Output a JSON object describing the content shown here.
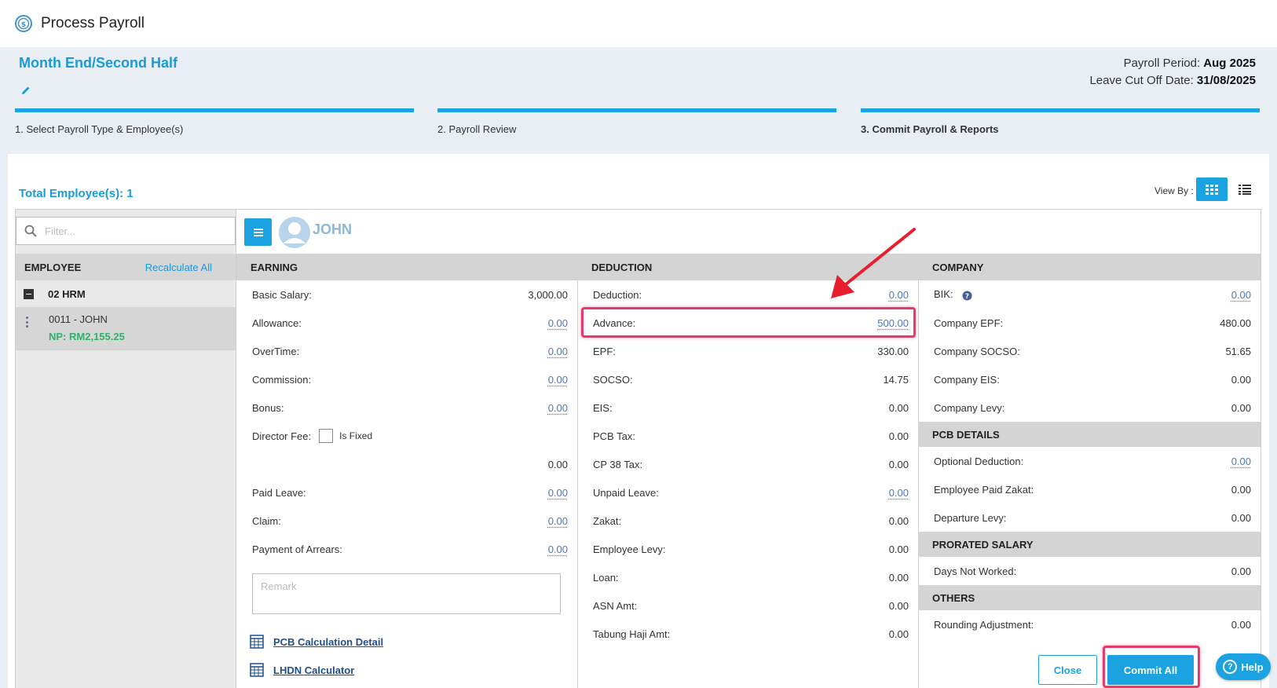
{
  "app": {
    "title": "Process Payroll"
  },
  "period": {
    "name": "Month End/Second Half",
    "payroll_period_label": "Payroll Period:",
    "payroll_period_value": "Aug 2025",
    "cutoff_label": "Leave Cut Off Date:",
    "cutoff_value": "31/08/2025"
  },
  "steps": [
    {
      "label": "1. Select Payroll Type & Employee(s)"
    },
    {
      "label": "2. Payroll Review"
    },
    {
      "label": "3. Commit Payroll & Reports"
    }
  ],
  "total_employees": "Total Employee(s): 1",
  "view_by": "View By :",
  "filter_placeholder": "Filter...",
  "employee_list": {
    "header": "EMPLOYEE",
    "recalculate": "Recalculate All",
    "group": "02 HRM",
    "employee": "0011 - JOHN",
    "net_pay": "NP: RM2,155.25"
  },
  "employee_name": "JOHN",
  "earning": {
    "title": "EARNING",
    "rows": [
      {
        "label": "Basic Salary:",
        "value": "3,000.00"
      },
      {
        "label": "Allowance:",
        "value": "0.00"
      },
      {
        "label": "OverTime:",
        "value": "0.00"
      },
      {
        "label": "Commission:",
        "value": "0.00"
      },
      {
        "label": "Bonus:",
        "value": "0.00"
      }
    ],
    "director_fee_label": "Director Fee:",
    "is_fixed_label": "Is Fixed",
    "director_fee_value": "0.00",
    "rows2": [
      {
        "label": "Paid Leave:",
        "value": "0.00"
      },
      {
        "label": "Claim:",
        "value": "0.00"
      },
      {
        "label": "Payment of Arrears:",
        "value": "0.00"
      }
    ],
    "remark_placeholder": "Remark",
    "pcb_link": "PCB Calculation Detail",
    "lhdn_link": "LHDN Calculator"
  },
  "deduction": {
    "title": "DEDUCTION",
    "rows": [
      {
        "label": "Deduction:",
        "value": "0.00"
      },
      {
        "label": "Advance:",
        "value": "500.00"
      },
      {
        "label": "EPF:",
        "value": "330.00"
      },
      {
        "label": "SOCSO:",
        "value": "14.75"
      },
      {
        "label": "EIS:",
        "value": "0.00"
      },
      {
        "label": "PCB Tax:",
        "value": "0.00"
      },
      {
        "label": "CP 38 Tax:",
        "value": "0.00"
      },
      {
        "label": "Unpaid Leave:",
        "value": "0.00"
      },
      {
        "label": "Zakat:",
        "value": "0.00"
      },
      {
        "label": "Employee Levy:",
        "value": "0.00"
      },
      {
        "label": "Loan:",
        "value": "0.00"
      },
      {
        "label": "ASN Amt:",
        "value": "0.00"
      },
      {
        "label": "Tabung Haji Amt:",
        "value": "0.00"
      }
    ]
  },
  "company": {
    "title": "COMPANY",
    "rows": [
      {
        "label": "BIK:",
        "value": "0.00"
      },
      {
        "label": "Company EPF:",
        "value": "480.00"
      },
      {
        "label": "Company SOCSO:",
        "value": "51.65"
      },
      {
        "label": "Company EIS:",
        "value": "0.00"
      },
      {
        "label": "Company Levy:",
        "value": "0.00"
      }
    ],
    "pcb_title": "PCB DETAILS",
    "pcb_rows": [
      {
        "label": "Optional Deduction:",
        "value": "0.00"
      },
      {
        "label": "Employee Paid Zakat:",
        "value": "0.00"
      },
      {
        "label": "Departure Levy:",
        "value": "0.00"
      }
    ],
    "prorated_title": "PRORATED SALARY",
    "prorated_rows": [
      {
        "label": "Days Not Worked:",
        "value": "0.00"
      }
    ],
    "others_title": "OTHERS",
    "others_rows": [
      {
        "label": "Rounding Adjustment:",
        "value": "0.00"
      }
    ]
  },
  "buttons": {
    "close": "Close",
    "commit": "Commit All",
    "help": "Help"
  },
  "colors": {
    "accent": "#1aa3e0",
    "highlight": "#e83a6a",
    "net_pay": "#2db36a"
  }
}
